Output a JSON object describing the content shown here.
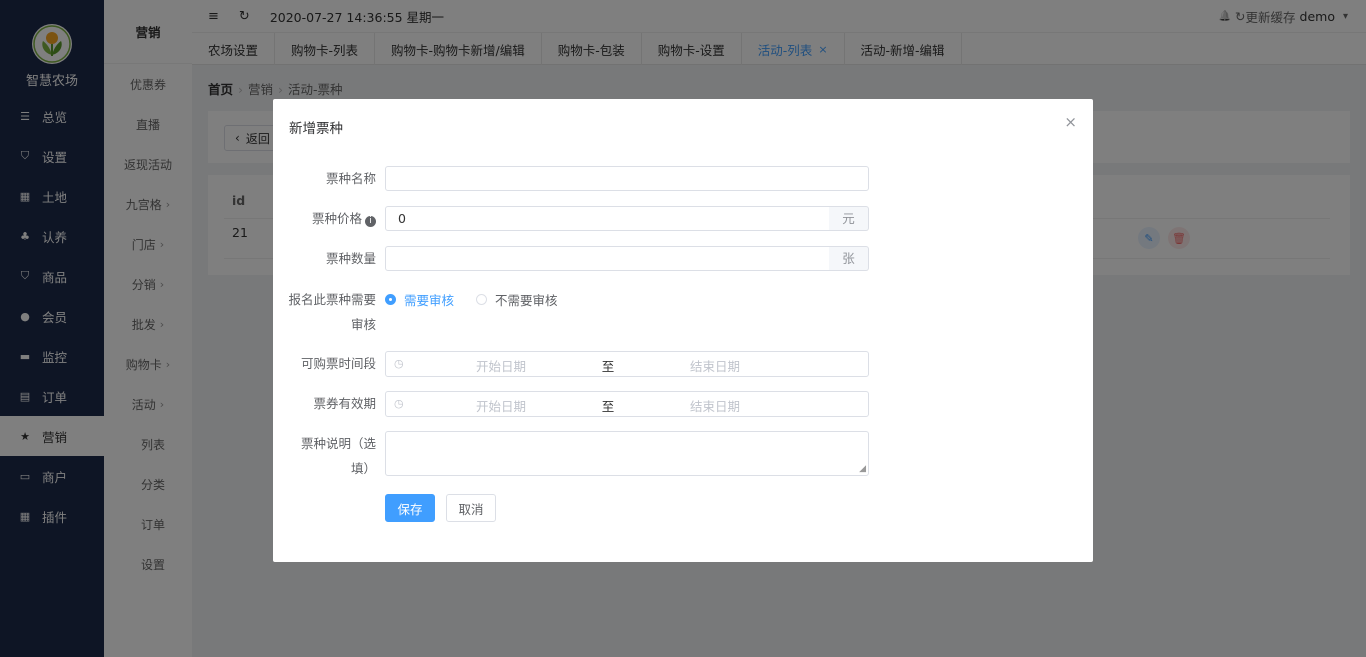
{
  "app": {
    "logo_text": "智慧农场"
  },
  "sidebar": {
    "items": [
      {
        "label": "总览",
        "icon": "sliders-icon",
        "glyph": "☰"
      },
      {
        "label": "设置",
        "icon": "bag-icon",
        "glyph": "⛉"
      },
      {
        "label": "土地",
        "icon": "grid-icon",
        "glyph": "▦"
      },
      {
        "label": "认养",
        "icon": "tree-icon",
        "glyph": "♣"
      },
      {
        "label": "商品",
        "icon": "shopping-bag-icon",
        "glyph": "⛉"
      },
      {
        "label": "会员",
        "icon": "user-icon",
        "glyph": "●"
      },
      {
        "label": "监控",
        "icon": "camera-icon",
        "glyph": "▬"
      },
      {
        "label": "订单",
        "icon": "clipboard-icon",
        "glyph": "▤"
      },
      {
        "label": "营销",
        "icon": "star-icon",
        "glyph": "★"
      },
      {
        "label": "商户",
        "icon": "store-icon",
        "glyph": "▭"
      },
      {
        "label": "插件",
        "icon": "apps-icon",
        "glyph": "▦"
      }
    ]
  },
  "subbar": {
    "title": "营销",
    "items": [
      {
        "label": "优惠券",
        "arrow": ""
      },
      {
        "label": "直播",
        "arrow": ""
      },
      {
        "label": "返现活动",
        "arrow": ""
      },
      {
        "label": "九宫格",
        "arrow": "›"
      },
      {
        "label": "门店",
        "arrow": "›"
      },
      {
        "label": "分销",
        "arrow": "›"
      },
      {
        "label": "批发",
        "arrow": "›"
      },
      {
        "label": "购物卡",
        "arrow": "›"
      },
      {
        "label": "活动",
        "arrow": "›"
      },
      {
        "label": "列表",
        "arrow": ""
      },
      {
        "label": "分类",
        "arrow": ""
      },
      {
        "label": "订单",
        "arrow": ""
      },
      {
        "label": "设置",
        "arrow": ""
      }
    ]
  },
  "topbar": {
    "menu_glyph": "≡",
    "refresh_glyph": "↻",
    "datetime": "2020-07-27 14:36:55 星期一",
    "bell_glyph": "🔔",
    "cache_glyph": "↻",
    "update_cache": "更新缓存",
    "user": "demo",
    "user_caret": "▾"
  },
  "tabs": [
    {
      "label": "农场设置"
    },
    {
      "label": "购物卡-列表"
    },
    {
      "label": "购物卡-购物卡新增/编辑"
    },
    {
      "label": "购物卡-包装"
    },
    {
      "label": "购物卡-设置"
    },
    {
      "label": "活动-列表",
      "close": "×"
    },
    {
      "label": "活动-新增-编辑"
    }
  ],
  "breadcrumb": {
    "home": "首页",
    "section": "营销",
    "page": "活动-票种",
    "sep": "›"
  },
  "page": {
    "back_label": "返回",
    "back_glyph": "‹",
    "table_header_id": "id",
    "row_id": "21",
    "edit_glyph": "✎",
    "delete_glyph": "🗑"
  },
  "dialog": {
    "title": "新增票种",
    "close_glyph": "×",
    "name_label": "票种名称",
    "name_value": "",
    "price_label": "票种价格",
    "price_info_glyph": "i",
    "price_value": "0",
    "price_unit": "元",
    "qty_label": "票种数量",
    "qty_value": "",
    "qty_unit": "张",
    "review_label_line1": "报名此票种需要",
    "review_label_line2": "审核",
    "review_options": [
      {
        "label": "需要审核",
        "checked": true
      },
      {
        "label": "不需要审核",
        "checked": false
      }
    ],
    "buy_period_label": "可购票时间段",
    "valid_period_label": "票券有效期",
    "start_placeholder": "开始日期",
    "end_placeholder": "结束日期",
    "range_sep": "至",
    "clock_glyph": "◷",
    "desc_label_line1": "票种说明（选",
    "desc_label_line2": "填）",
    "save_label": "保存",
    "cancel_label": "取消"
  },
  "colors": {
    "sidebar_bg": "#1d2a4a",
    "primary": "#409eff",
    "mask": "rgba(0,0,0,0.5)"
  }
}
